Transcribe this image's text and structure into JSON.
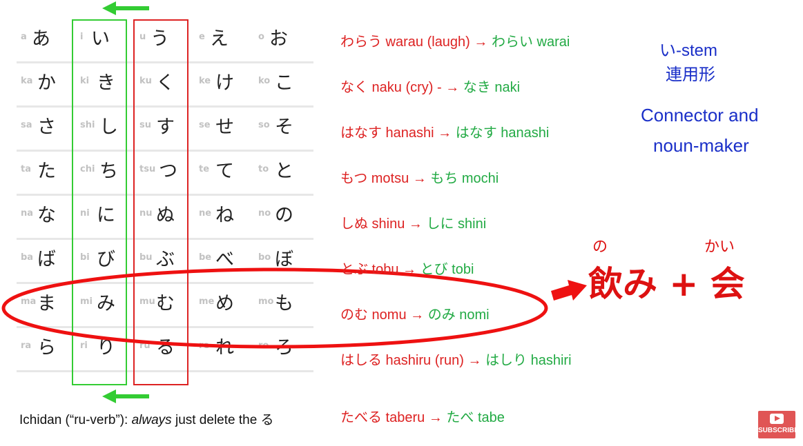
{
  "rows": [
    [
      [
        "a",
        "あ"
      ],
      [
        "i",
        "い"
      ],
      [
        "u",
        "う"
      ],
      [
        "e",
        "え"
      ],
      [
        "o",
        "お"
      ]
    ],
    [
      [
        "ka",
        "か"
      ],
      [
        "ki",
        "き"
      ],
      [
        "ku",
        "く"
      ],
      [
        "ke",
        "け"
      ],
      [
        "ko",
        "こ"
      ]
    ],
    [
      [
        "sa",
        "さ"
      ],
      [
        "shi",
        "し"
      ],
      [
        "su",
        "す"
      ],
      [
        "se",
        "せ"
      ],
      [
        "so",
        "そ"
      ]
    ],
    [
      [
        "ta",
        "た"
      ],
      [
        "chi",
        "ち"
      ],
      [
        "tsu",
        "つ"
      ],
      [
        "te",
        "て"
      ],
      [
        "to",
        "と"
      ]
    ],
    [
      [
        "na",
        "な"
      ],
      [
        "ni",
        "に"
      ],
      [
        "nu",
        "ぬ"
      ],
      [
        "ne",
        "ね"
      ],
      [
        "no",
        "の"
      ]
    ],
    [
      [
        "ba",
        "ば"
      ],
      [
        "bi",
        "び"
      ],
      [
        "bu",
        "ぶ"
      ],
      [
        "be",
        "べ"
      ],
      [
        "bo",
        "ぼ"
      ]
    ],
    [
      [
        "ma",
        "ま"
      ],
      [
        "mi",
        "み"
      ],
      [
        "mu",
        "む"
      ],
      [
        "me",
        "め"
      ],
      [
        "mo",
        "も"
      ]
    ],
    [
      [
        "ra",
        "ら"
      ],
      [
        "ri",
        "り"
      ],
      [
        "ru",
        "る"
      ],
      [
        "re",
        "れ"
      ],
      [
        "ro",
        "ろ"
      ]
    ]
  ],
  "examples": [
    {
      "red": "わらう warau (laugh) → ",
      "green": "わらい warai"
    },
    {
      "red": "なく naku (cry) - → ",
      "green": "なき  naki"
    },
    {
      "red": "はなす hanashi → ",
      "green": "はなす hanashi"
    },
    {
      "red": "もつ  motsu → ",
      "green": "もち mochi"
    },
    {
      "red": "しぬ shinu → ",
      "green": "しに shini"
    },
    {
      "red": "とぶ tobu → ",
      "green": "とび  tobi"
    },
    {
      "red": "のむ nomu → ",
      "green": "のみ  nomi"
    },
    {
      "red": "はしる hashiru (run)  → ",
      "green": "はしり hashiri"
    },
    {
      "red": "たべる taberu → ",
      "green": "たべ tabe"
    }
  ],
  "side": {
    "stem_line1": "い-stem",
    "stem_line2": "連用形",
    "connector_line1": "Connector and",
    "connector_line2": "noun-maker"
  },
  "compound": {
    "text": "飲み + 会",
    "ruby_no": "の",
    "ruby_kai": "かい"
  },
  "footnote": {
    "before": "Ichidan (“ru-verb”): ",
    "em": "always",
    "after": " just delete the る"
  },
  "subscribe_label": "SUBSCRIBE",
  "colors": {
    "red": "#dd2222",
    "green": "#22aa44",
    "blue": "#1a2fc8",
    "box_green": "#33cc33"
  }
}
